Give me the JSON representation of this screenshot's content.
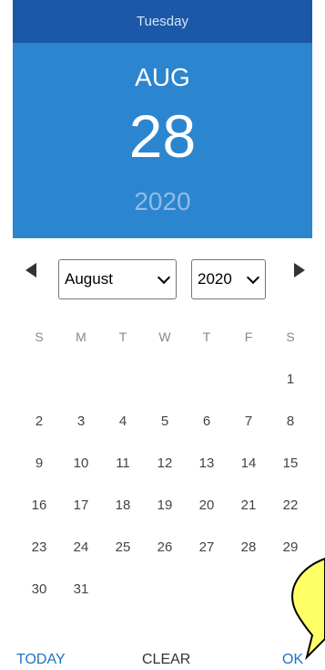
{
  "header": {
    "weekday": "Tuesday",
    "month": "AUG",
    "date": "28",
    "year": "2020"
  },
  "nav": {
    "month_select": "August",
    "year_select": "2020"
  },
  "weekdays": [
    "S",
    "M",
    "T",
    "W",
    "T",
    "F",
    "S"
  ],
  "days": [
    [
      "",
      "",
      "",
      "",
      "",
      "",
      "1"
    ],
    [
      "2",
      "3",
      "4",
      "5",
      "6",
      "7",
      "8"
    ],
    [
      "9",
      "10",
      "11",
      "12",
      "13",
      "14",
      "15"
    ],
    [
      "16",
      "17",
      "18",
      "19",
      "20",
      "21",
      "22"
    ],
    [
      "23",
      "24",
      "25",
      "26",
      "27",
      "28",
      "29"
    ],
    [
      "30",
      "31",
      "",
      "",
      "",
      "",
      ""
    ]
  ],
  "footer": {
    "today_label": "TODAY",
    "clear_label": "CLEAR",
    "ok_label": "OK"
  },
  "colors": {
    "header_top": "#1b59a8",
    "header_main": "#2c85cf",
    "accent": "#1e73c2",
    "callout": "#ffff66"
  }
}
